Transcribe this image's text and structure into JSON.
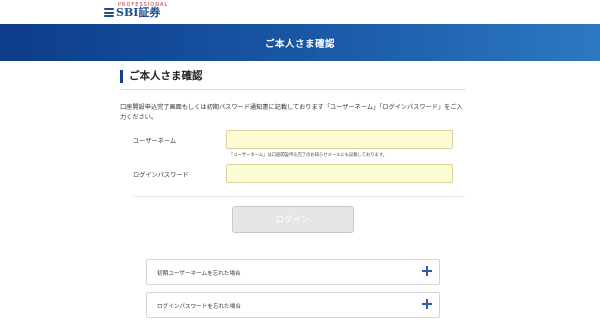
{
  "header": {
    "logo_tagline": "PROFESSIONAL",
    "logo_text": "SBI証券",
    "brand_color": "#1e4d8f"
  },
  "banner": {
    "title": "ご本人さま確認",
    "gradient_start": "#0d3c8a",
    "gradient_end": "#2d78c2"
  },
  "main": {
    "heading": "ご本人さま確認",
    "instruction": "口座開設申込完了画面もしくは初期パスワード通知書に記載しております「ユーザーネーム」「ログインパスワード」をご入力ください。"
  },
  "form": {
    "username": {
      "label": "ユーザーネーム",
      "value": "",
      "note": "「ユーザーネーム」は口座開設申込完了のお知らせメールにも記載しております。"
    },
    "password": {
      "label": "ログインパスワード",
      "value": ""
    },
    "input_bg_color": "#fdfcd5",
    "login_button": {
      "label": "ログイン",
      "state": "disabled"
    }
  },
  "help": {
    "items": [
      {
        "label": "初期ユーザーネームを忘れた場合",
        "icon": "plus-icon"
      },
      {
        "label": "ログインパスワードを忘れた場合",
        "icon": "plus-icon"
      }
    ]
  }
}
